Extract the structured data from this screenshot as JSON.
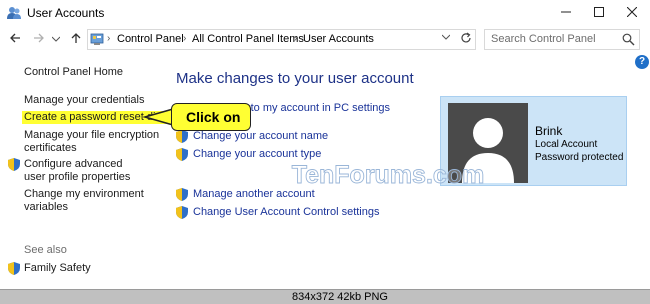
{
  "window": {
    "title": "User Accounts",
    "controls": {
      "minimize_icon": "minimize-icon",
      "maximize_icon": "maximize-icon",
      "close_icon": "close-icon"
    }
  },
  "nav": {
    "breadcrumbs": [
      "Control Panel",
      "All Control Panel Items",
      "User Accounts"
    ],
    "search_placeholder": "Search Control Panel"
  },
  "sidebar": {
    "home": "Control Panel Home",
    "items": [
      "Manage your credentials",
      "Create a password reset disk",
      "Manage your file encryption certificates",
      "Configure advanced user profile properties",
      "Change my environment variables"
    ],
    "see_also_label": "See also",
    "see_also_items": [
      "Family Safety"
    ]
  },
  "main": {
    "title": "Make changes to your user account",
    "links": [
      "Make changes to my account in PC settings",
      "Change your account name",
      "Change your account type",
      "Manage another account",
      "Change User Account Control settings"
    ]
  },
  "callout": {
    "text": "Click on"
  },
  "user": {
    "name": "Brink",
    "type": "Local Account",
    "status": "Password protected"
  },
  "watermark": {
    "text": "TenForums.com"
  },
  "status_strip": {
    "text": "834x372  42kb  PNG"
  },
  "colors": {
    "highlight": "#ffff33",
    "link": "#1a3399",
    "card": "#cce4f7"
  }
}
